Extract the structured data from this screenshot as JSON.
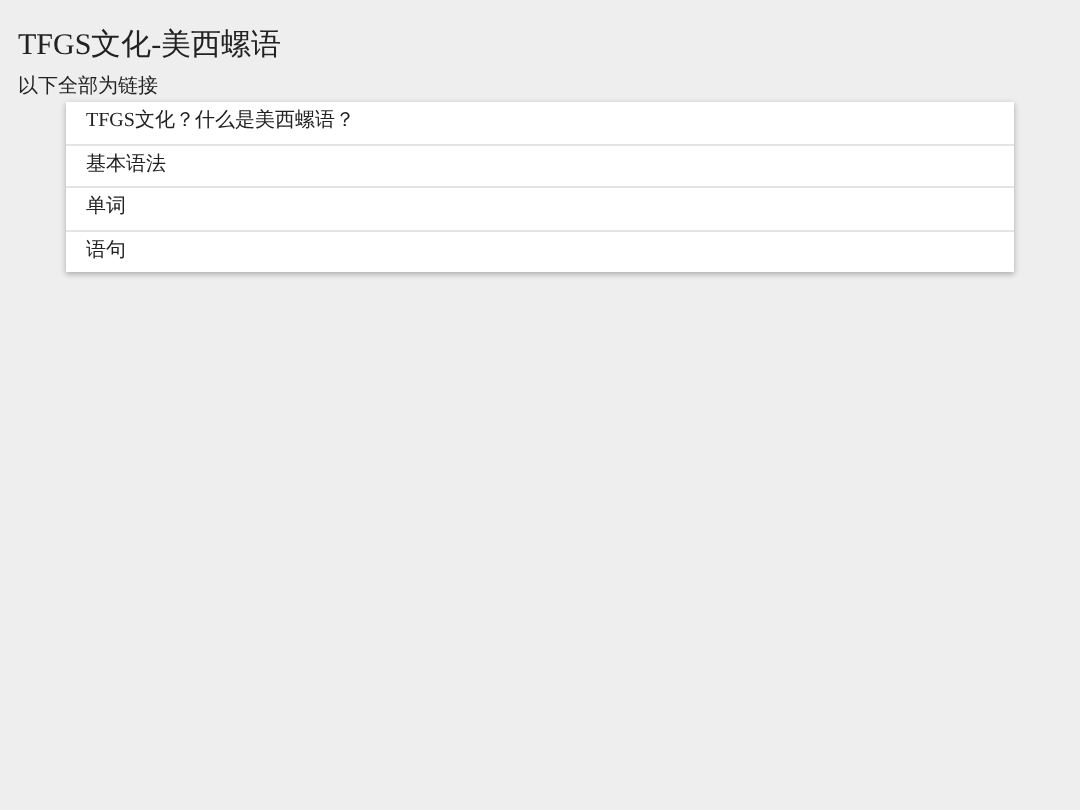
{
  "title": "TFGS文化-美西螺语",
  "subtitle": "以下全部为链接",
  "menu": [
    {
      "label": "TFGS文化？什么是美西螺语？"
    },
    {
      "label": "基本语法"
    },
    {
      "label": "单词"
    },
    {
      "label": "语句"
    }
  ]
}
